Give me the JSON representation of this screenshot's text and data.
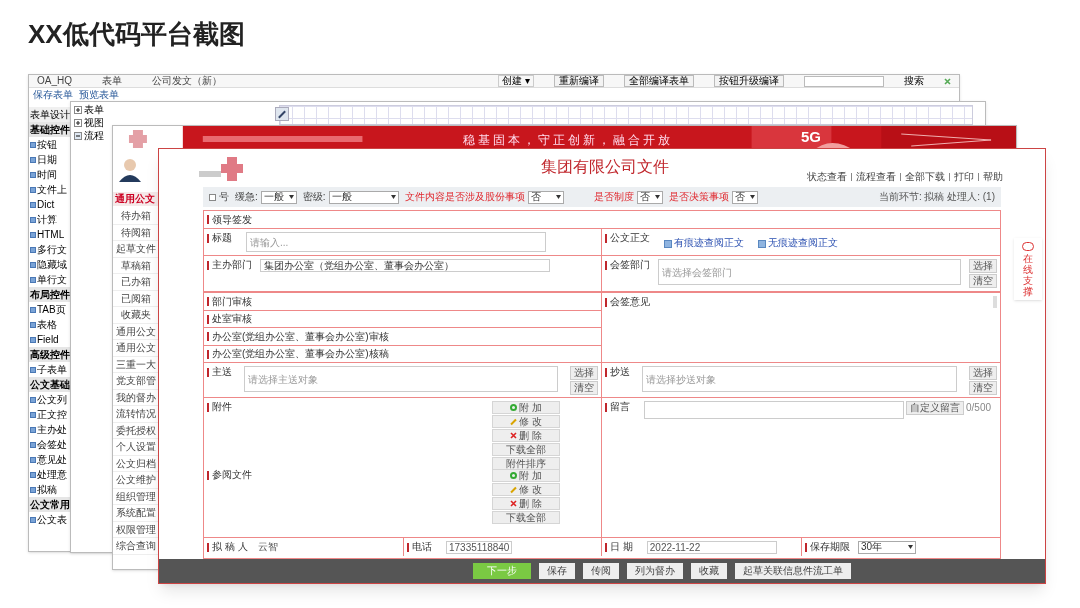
{
  "title": "XX低代码平台截图",
  "designer": {
    "menu": [
      "OA_HQ",
      "表单",
      "公司发文（新）"
    ],
    "toolbar": [
      "保存表单",
      "预览表单"
    ],
    "create": "创建 ▾",
    "actions": [
      "重新编译",
      "全部编译表单",
      "按钮升级编译"
    ],
    "search_button": "搜索",
    "sidebar": [
      {
        "kind": "header",
        "label": "表单设计"
      },
      {
        "kind": "group",
        "label": "基础控件"
      },
      {
        "kind": "item",
        "label": "按钮"
      },
      {
        "kind": "item",
        "label": "日期"
      },
      {
        "kind": "item",
        "label": "时间"
      },
      {
        "kind": "item",
        "label": "文件上"
      },
      {
        "kind": "item",
        "label": "Dict"
      },
      {
        "kind": "item",
        "label": "计算"
      },
      {
        "kind": "item",
        "label": "HTML"
      },
      {
        "kind": "item",
        "label": "多行文"
      },
      {
        "kind": "item",
        "label": "隐藏域"
      },
      {
        "kind": "item",
        "label": "单行文"
      },
      {
        "kind": "group",
        "label": "布局控件"
      },
      {
        "kind": "item",
        "label": "TAB页"
      },
      {
        "kind": "item",
        "label": "表格"
      },
      {
        "kind": "item",
        "label": "Field"
      },
      {
        "kind": "group",
        "label": "高级控件"
      },
      {
        "kind": "item",
        "label": "子表单"
      },
      {
        "kind": "group",
        "label": "公文基础"
      },
      {
        "kind": "item",
        "label": "公文列"
      },
      {
        "kind": "item",
        "label": "正文控"
      },
      {
        "kind": "item",
        "label": "主办处"
      },
      {
        "kind": "item",
        "label": "会签处"
      },
      {
        "kind": "item",
        "label": "意见处"
      },
      {
        "kind": "item",
        "label": "处理意"
      },
      {
        "kind": "item",
        "label": "拟稿"
      },
      {
        "kind": "group",
        "label": "公文常用"
      },
      {
        "kind": "item",
        "label": "公文表"
      }
    ]
  },
  "tree": [
    {
      "label": "表单",
      "expanded": false
    },
    {
      "label": "视图",
      "expanded": false
    },
    {
      "label": "流程",
      "expanded": true
    }
  ],
  "portal": {
    "slogan": "稳基固本，守正创新，融合开放",
    "badge": "5G",
    "section": "通用公文",
    "nav": [
      "待办箱",
      "待阅箱",
      "起草文件",
      "草稿箱",
      "已办箱",
      "已阅箱",
      "收藏夹",
      "通用公文",
      "通用公文",
      "三重一大",
      "党支部管",
      "我的督办",
      "流转情况",
      "委托授权",
      "个人设置",
      "公文归档",
      "公文维护",
      "组织管理",
      "系统配置",
      "权限管理",
      "综合查询"
    ]
  },
  "document": {
    "heading": "集团有限公司文件",
    "links": [
      "状态查看",
      "流程查看",
      "全部下载",
      "打印",
      "帮助"
    ],
    "toolbar_left": [
      {
        "label": "号",
        "kind": "checkbox",
        "checked": false
      },
      {
        "label": "缓急:",
        "kind": "select",
        "value": "一般"
      },
      {
        "label": "密级:",
        "kind": "select",
        "value": "一般"
      },
      {
        "label": "文件内容是否涉及股份事项",
        "kind": "select",
        "value": "否",
        "highlight": true
      }
    ],
    "toolbar_right": [
      {
        "label": "是否制度",
        "kind": "select",
        "value": "否",
        "highlight": true
      },
      {
        "label": "是否决策事项",
        "kind": "select",
        "value": "否",
        "highlight": true
      }
    ],
    "current": "当前环节: 拟稿  处理人: (1)",
    "form": {
      "leader_sign": "领导签发",
      "title": {
        "label": "标题",
        "placeholder": "请输入..."
      },
      "body": {
        "label": "公文正文",
        "links": [
          "有痕迹查阅正文",
          "无痕迹查阅正文"
        ]
      },
      "host_dept": {
        "label": "主办部门",
        "value": "集团办公室（党组办公室、董事会办公室）"
      },
      "cosign_dept": {
        "label": "会签部门",
        "placeholder": "请选择会签部门",
        "buttons": [
          "选择",
          "清空"
        ]
      },
      "reviews": [
        "部门审核",
        "处室审核",
        "办公室(党组办公室、董事会办公室)审核",
        "办公室(党组办公室、董事会办公室)核稿"
      ],
      "cosign_opinion": "会签意见",
      "main_send": {
        "label": "主送",
        "placeholder": "请选择主送对象",
        "buttons": [
          "选择",
          "清空"
        ]
      },
      "copy_send": {
        "label": "抄送",
        "placeholder": "请选择抄送对象",
        "buttons": [
          "选择",
          "清空"
        ]
      },
      "attachments": {
        "label": "附件",
        "buttons": [
          {
            "kind": "add",
            "label": "附 加"
          },
          {
            "kind": "edit",
            "label": "修 改"
          },
          {
            "kind": "delete",
            "label": "删 除"
          },
          {
            "kind": "plain",
            "label": "下载全部"
          },
          {
            "kind": "plain",
            "label": "附件排序"
          }
        ]
      },
      "references": {
        "label": "参阅文件",
        "buttons": [
          {
            "kind": "add",
            "label": "附 加"
          },
          {
            "kind": "edit",
            "label": "修 改"
          },
          {
            "kind": "delete",
            "label": "删 除"
          },
          {
            "kind": "plain",
            "label": "下载全部"
          }
        ]
      },
      "message": {
        "label": "留言",
        "button": "自定义留言",
        "count": "0/500"
      },
      "drafter": {
        "label": "拟 稿 人",
        "value": "云智"
      },
      "phone": {
        "label": "电话",
        "value": "17335118840"
      },
      "date": {
        "label": "日 期",
        "value": "2022-11-22"
      },
      "retention": {
        "label": "保存期限",
        "value": "30年"
      }
    },
    "actions": [
      {
        "label": "下一步",
        "primary": true
      },
      {
        "label": "保存",
        "primary": false
      },
      {
        "label": "传阅",
        "primary": false
      },
      {
        "label": "列为督办",
        "primary": false
      },
      {
        "label": "收藏",
        "primary": false
      },
      {
        "label": "起草关联信息件流工单",
        "primary": false
      }
    ],
    "support": "在线支撑"
  }
}
